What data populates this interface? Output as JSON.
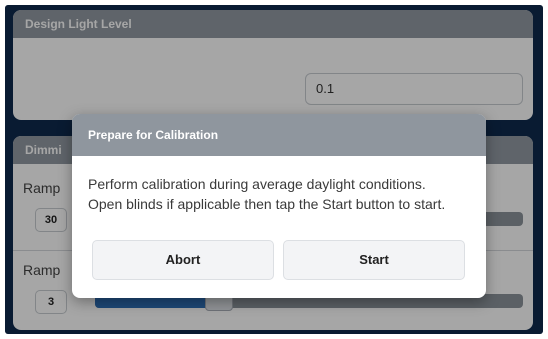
{
  "design_panel": {
    "title": "Design Light Level",
    "input_value": "0.1"
  },
  "dimming_panel": {
    "title": "Dimmi",
    "rows": [
      {
        "label": "Ramp",
        "value": "30"
      },
      {
        "label": "Ramp",
        "value": "3",
        "level_fraction": 0.27
      }
    ]
  },
  "modal": {
    "title": "Prepare for Calibration",
    "message_line1": "Perform calibration during average daylight conditions.",
    "message_line2": "Open blinds if applicable then tap the Start button to start.",
    "abort_label": "Abort",
    "start_label": "Start"
  },
  "colors": {
    "frame": "#0f2a4e",
    "header": "#929aa3",
    "accent": "#2d6fb8"
  }
}
